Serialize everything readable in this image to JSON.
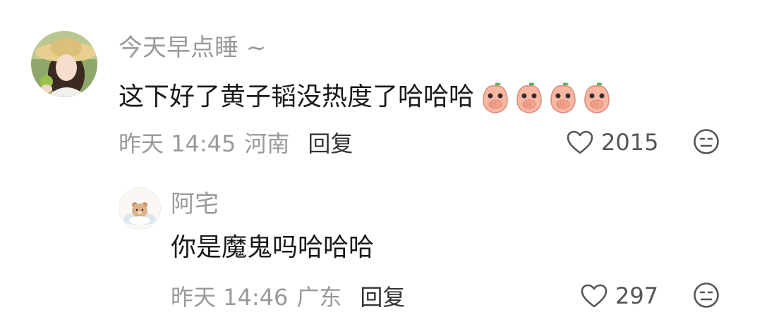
{
  "comments": [
    {
      "username": "今天早点睡 ~",
      "text": "这下好了黄子韬没热度了哈哈哈",
      "emoji_icon": "peach-cover-mouth-emoji",
      "emoji_count": 4,
      "time": "昨天 14:45",
      "location": "河南",
      "reply_label": "回复",
      "likes": "2015",
      "like_icon": "heart-outline-icon",
      "dislike_icon": "neutral-face-icon"
    },
    {
      "username": "阿宅",
      "text": "你是魔鬼吗哈哈哈",
      "time": "昨天 14:46",
      "location": "广东",
      "reply_label": "回复",
      "likes": "297",
      "like_icon": "heart-outline-icon",
      "dislike_icon": "neutral-face-icon"
    }
  ],
  "colors": {
    "meta_gray": "#9a9a9a",
    "text_dark": "#1a1a1a",
    "icon_gray": "#555555"
  }
}
